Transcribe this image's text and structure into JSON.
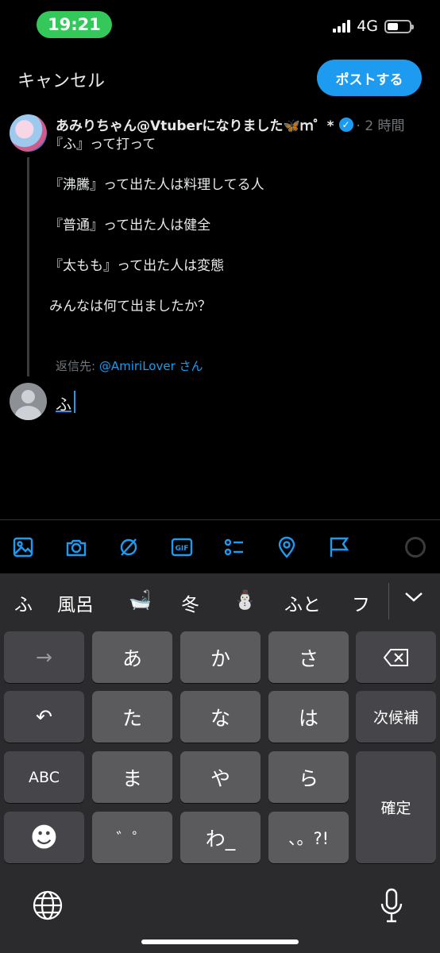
{
  "status_bar": {
    "time": "19:21",
    "network": "4G",
    "battery_level": 0.5,
    "time_pill_color": "#34c759"
  },
  "nav": {
    "cancel_label": "キャンセル",
    "post_label": "ポストする",
    "accent_color": "#1d9bf0"
  },
  "original_post": {
    "display_name": "あみりちゃん@Vtuberになりました🦋ｍ゜*",
    "verified": true,
    "time_ago": "· 2 時間",
    "lines": [
      "『ふ』って打って",
      "『沸騰』って出た人は料理してる人",
      "『普通』って出た人は健全",
      "『太もも』って出た人は変態",
      "みんなは何て出ましたか？"
    ],
    "reply_prefix": "返信先:",
    "reply_handle": "@AmiriLover",
    "reply_suffix": "さん"
  },
  "composer": {
    "value": "ふ"
  },
  "toolbar_icons": [
    "image-icon",
    "camera-icon",
    "grok-icon",
    "gif-icon",
    "poll-icon",
    "location-icon",
    "flag-icon"
  ],
  "keyboard": {
    "candidates": [
      "ふ",
      "風呂",
      "🛁",
      "冬",
      "⛄",
      "ふと",
      "フ"
    ],
    "keys": {
      "arrow": "→",
      "a": "あ",
      "ka": "か",
      "sa": "さ",
      "backspace": "⌫",
      "undo": "↶",
      "ta": "た",
      "na": "な",
      "ha": "は",
      "next_candidate": "次候補",
      "abc": "ABC",
      "ma": "ま",
      "ya": "や",
      "ra": "ら",
      "confirm": "確定",
      "emoji": "☻",
      "dakuten": "゛゜",
      "wa": "わ_",
      "punct": "、。?!"
    }
  }
}
